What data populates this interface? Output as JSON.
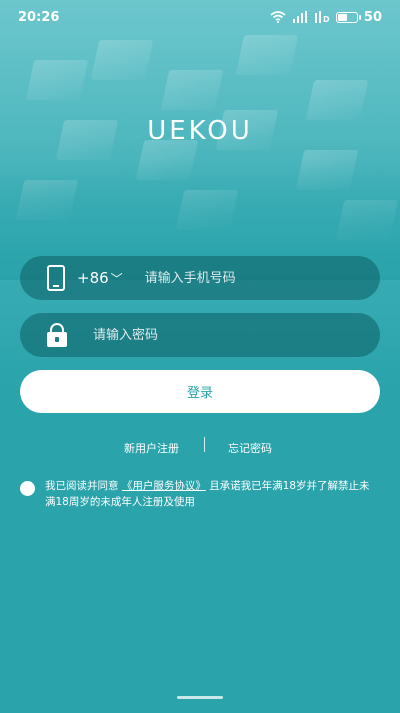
{
  "status_bar": {
    "time": "20:26",
    "battery_level": "50",
    "icons": [
      "wifi-icon",
      "signal-icon",
      "hd-icon",
      "battery-icon"
    ]
  },
  "app": {
    "logo_text": "UEKOU"
  },
  "login_form": {
    "phone": {
      "country_code": "+86",
      "placeholder": "请输入手机号码"
    },
    "password": {
      "placeholder": "请输入密码"
    },
    "login_label": "登录"
  },
  "links": {
    "register_label": "新用户注册",
    "forgot_label": "忘记密码"
  },
  "agreement": {
    "prefix": "我已阅读并同意",
    "link_label": "《用户服务协议》",
    "suffix": "且承诺我已年满18岁并了解禁止未满18周岁的未成年人注册及使用"
  },
  "colors": {
    "background": "#2aa3ab",
    "field_background": "#0c5f64",
    "button_text": "#2aa3ab"
  }
}
